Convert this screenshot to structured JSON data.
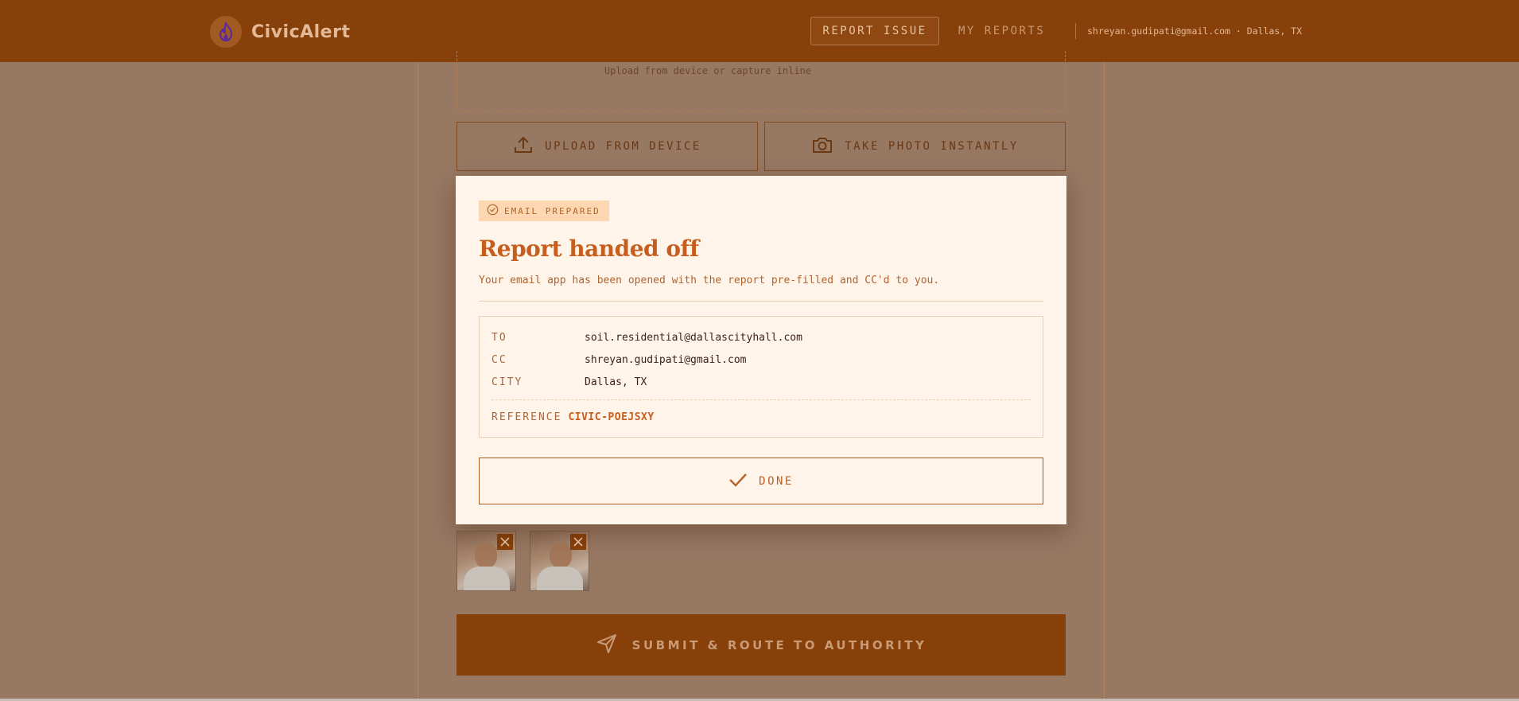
{
  "header": {
    "brand": "CivicAlert",
    "nav_report": "REPORT ISSUE",
    "nav_my_reports": "MY REPORTS",
    "user": "shreyan.gudipati@gmail.com · Dallas, TX"
  },
  "form": {
    "upload_hint": "Upload from device or capture inline",
    "upload_button": "UPLOAD FROM DEVICE",
    "photo_button": "TAKE PHOTO INSTANTLY",
    "submit_button": "SUBMIT & ROUTE TO AUTHORITY"
  },
  "modal": {
    "chip": "EMAIL PREPARED",
    "title": "Report handed off",
    "subtitle": "Your email app has been opened with the report pre-filled and CC'd to you.",
    "details": {
      "to_label": "TO",
      "to_value": "soil.residential@dallascityhall.com",
      "cc_label": "CC",
      "cc_value": "shreyan.gudipati@gmail.com",
      "city_label": "CITY",
      "city_value": "Dallas, TX",
      "reference_label": "REFERENCE",
      "reference_value": "CIVIC-POEJSXY"
    },
    "done_button": "DONE"
  },
  "icons": {
    "logo": "flame-icon",
    "upload": "upload-icon",
    "camera": "camera-icon",
    "remove": "close-icon",
    "check_circle": "check-circle-icon",
    "done": "check-icon",
    "send": "send-icon"
  },
  "colors": {
    "brand": "#88400a",
    "accent": "#c65f1e",
    "modal_bg": "#fff4ea",
    "chip_bg": "#fcd7b1"
  }
}
